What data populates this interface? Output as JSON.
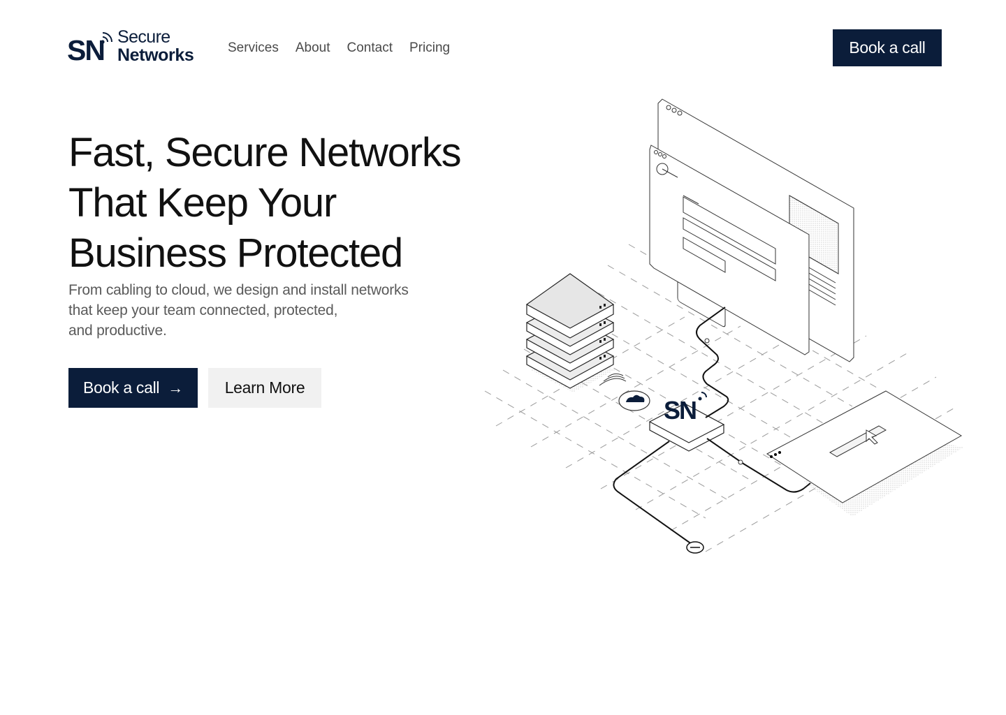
{
  "brand": {
    "mark": "SN",
    "line1": "Secure",
    "line2": "Networks",
    "color": "#0b1d3a"
  },
  "nav": {
    "items": [
      {
        "label": "Services"
      },
      {
        "label": "About"
      },
      {
        "label": "Contact"
      },
      {
        "label": "Pricing"
      }
    ]
  },
  "header": {
    "cta_label": "Book a call"
  },
  "hero": {
    "title_lines": [
      "Fast, Secure Networks",
      "That Keep Your",
      "Business Protected"
    ],
    "subtitle_lines": [
      "From cabling to cloud, we design and install networks",
      "that keep your team connected, protected,",
      "and productive."
    ],
    "primary_cta": "Book a call",
    "primary_cta_icon": "arrow-right-icon",
    "secondary_cta": "Learn More"
  },
  "illustration": {
    "mark": "SN",
    "icons": [
      "server-stack-icon",
      "cloud-icon",
      "router-icon",
      "browser-window-icon",
      "cursor-icon",
      "plug-icon"
    ]
  },
  "colors": {
    "primary": "#0b1d3a",
    "secondary_bg": "#f1f1f1",
    "body_text": "#5a5a5a"
  }
}
